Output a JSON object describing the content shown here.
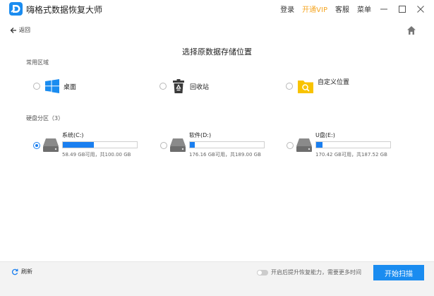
{
  "titlebar": {
    "app_title": "嗨格式数据恢复大师",
    "menu": {
      "login": "登录",
      "vip": "开通VIP",
      "service": "客服",
      "menu": "菜单"
    }
  },
  "nav": {
    "back_label": "返回"
  },
  "page_title": "选择原数据存储位置",
  "common": {
    "label": "常用区域",
    "items": [
      {
        "label": "桌面",
        "icon": "windows-icon"
      },
      {
        "label": "回收站",
        "icon": "recycle-bin-icon"
      },
      {
        "label": "自定义位置",
        "icon": "folder-search-icon"
      }
    ]
  },
  "disks": {
    "label": "硬盘分区（3）",
    "items": [
      {
        "name": "系统(C:)",
        "info": "58.49 GB可用，共100.00 GB",
        "used_fraction": 0.415,
        "selected": true
      },
      {
        "name": "软件(D:)",
        "info": "176.16 GB可用，共189.00 GB",
        "used_fraction": 0.07,
        "selected": false
      },
      {
        "name": "U盘(E:)",
        "info": "170.42 GB可用，共187.52 GB",
        "used_fraction": 0.09,
        "selected": false
      }
    ]
  },
  "footer": {
    "refresh_label": "刷新",
    "toggle_label": "开启后提升恢复能力，需要更多时间",
    "start_label": "开始扫描"
  },
  "colors": {
    "accent": "#1a7ff0",
    "vip": "#f5a623",
    "folder": "#f8c300"
  }
}
